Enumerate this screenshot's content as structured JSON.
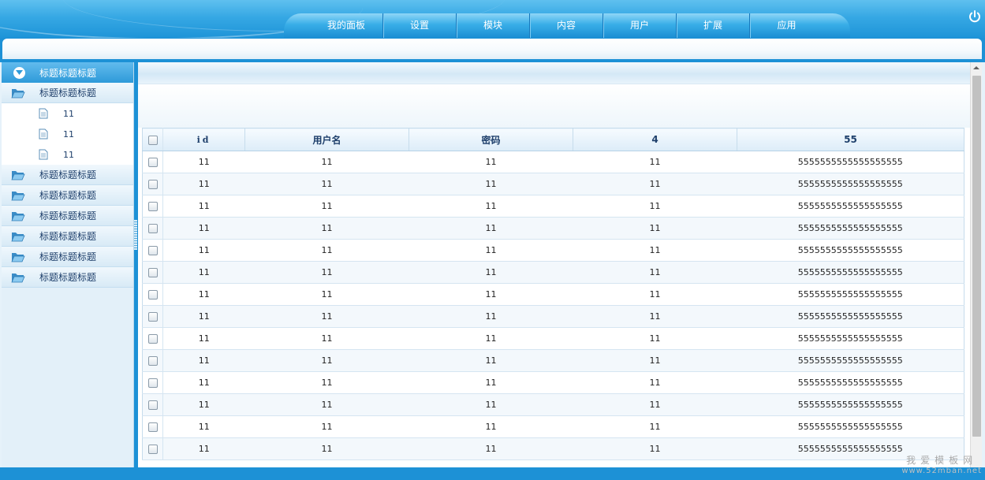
{
  "nav": {
    "items": [
      {
        "label": "我的面板"
      },
      {
        "label": "设置"
      },
      {
        "label": "模块"
      },
      {
        "label": "内容"
      },
      {
        "label": "用户"
      },
      {
        "label": "扩展"
      },
      {
        "label": "应用"
      }
    ],
    "power_icon": "power-icon"
  },
  "sidebar": {
    "header": {
      "label": "标题标题标题",
      "icon": "chevron-down-icon"
    },
    "groups": [
      {
        "label": "标题标题标题",
        "icon": "folder-open-icon",
        "children": [
          {
            "label": "11"
          },
          {
            "label": "11"
          },
          {
            "label": "11"
          }
        ]
      },
      {
        "label": "标题标题标题",
        "icon": "folder-open-icon"
      },
      {
        "label": "标题标题标题",
        "icon": "folder-open-icon"
      },
      {
        "label": "标题标题标题",
        "icon": "folder-open-icon"
      },
      {
        "label": "标题标题标题",
        "icon": "folder-open-icon"
      },
      {
        "label": "标题标题标题",
        "icon": "folder-open-icon"
      },
      {
        "label": "标题标题标题",
        "icon": "folder-open-icon"
      }
    ]
  },
  "table": {
    "columns": [
      "id",
      "用户名",
      "密码",
      "4",
      "55"
    ],
    "rows": [
      [
        "11",
        "11",
        "11",
        "11",
        "5555555555555555555"
      ],
      [
        "11",
        "11",
        "11",
        "11",
        "5555555555555555555"
      ],
      [
        "11",
        "11",
        "11",
        "11",
        "5555555555555555555"
      ],
      [
        "11",
        "11",
        "11",
        "11",
        "5555555555555555555"
      ],
      [
        "11",
        "11",
        "11",
        "11",
        "5555555555555555555"
      ],
      [
        "11",
        "11",
        "11",
        "11",
        "5555555555555555555"
      ],
      [
        "11",
        "11",
        "11",
        "11",
        "5555555555555555555"
      ],
      [
        "11",
        "11",
        "11",
        "11",
        "5555555555555555555"
      ],
      [
        "11",
        "11",
        "11",
        "11",
        "5555555555555555555"
      ],
      [
        "11",
        "11",
        "11",
        "11",
        "5555555555555555555"
      ],
      [
        "11",
        "11",
        "11",
        "11",
        "5555555555555555555"
      ],
      [
        "11",
        "11",
        "11",
        "11",
        "5555555555555555555"
      ],
      [
        "11",
        "11",
        "11",
        "11",
        "5555555555555555555"
      ],
      [
        "11",
        "11",
        "11",
        "11",
        "5555555555555555555"
      ]
    ]
  },
  "watermark": {
    "line1": "我爱模板网",
    "line2": "www.52mban.net"
  },
  "colors": {
    "accent": "#1d91d6",
    "header_light": "#5fc0ef",
    "text_dark": "#1e3f6b"
  }
}
